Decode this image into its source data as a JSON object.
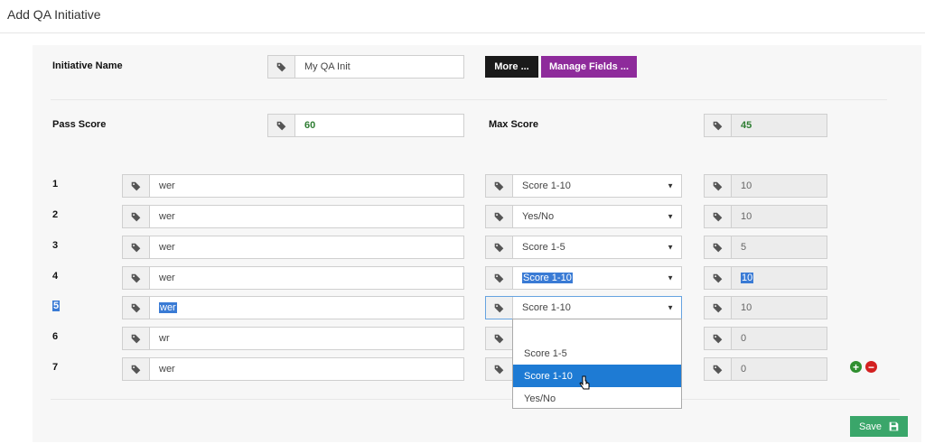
{
  "page": {
    "title": "Add QA Initiative"
  },
  "header": {
    "initiative_name_label": "Initiative Name",
    "initiative_name_value": "My QA Init",
    "more_button": "More ...",
    "manage_fields_button": "Manage Fields ..."
  },
  "scores": {
    "pass_label": "Pass Score",
    "pass_value": "60",
    "max_label": "Max Score",
    "max_value": "45"
  },
  "rows": [
    {
      "num": "1",
      "name": "wer",
      "scale": "Score 1-10",
      "max": "10"
    },
    {
      "num": "2",
      "name": "wer",
      "scale": "Yes/No",
      "max": "10"
    },
    {
      "num": "3",
      "name": "wer",
      "scale": "Score 1-5",
      "max": "5"
    },
    {
      "num": "4",
      "name": "wer",
      "scale": "Score 1-10",
      "max": "10"
    },
    {
      "num": "5",
      "name": "wer",
      "scale": "Score 1-10",
      "max": "10"
    },
    {
      "num": "6",
      "name": "wr",
      "scale": "",
      "max": "0"
    },
    {
      "num": "7",
      "name": "wer",
      "scale": "",
      "max": "0"
    }
  ],
  "dropdown": {
    "options": [
      "",
      "Score 1-5",
      "Score 1-10",
      "Yes/No"
    ],
    "highlighted": "Score 1-10"
  },
  "actions": {
    "save_label": "Save"
  },
  "colors": {
    "manage_button": "#8e2b9b",
    "more_button": "#1a1a1a",
    "save_button": "#3aa66a",
    "score_text": "#2e7d32",
    "highlight": "#1e7bd4"
  }
}
